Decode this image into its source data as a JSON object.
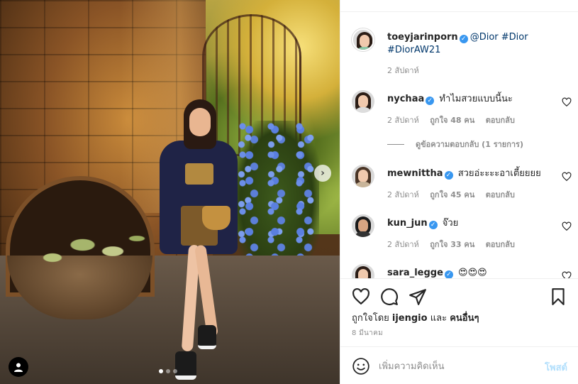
{
  "post": {
    "author": "toeyjarinporn",
    "caption_mention": "@Dior",
    "caption_tags": [
      "#Dior",
      "#DiorAW21"
    ],
    "time": "2 สัปดาห์"
  },
  "comments": [
    {
      "user": "nychaa",
      "verified": true,
      "text": "ทำไมสวยแบบนี้นะ",
      "time": "2 สัปดาห์",
      "likes": "ถูกใจ 48 คน",
      "reply": "ตอบกลับ",
      "view_replies": "ดูข้อความตอบกลับ (1 รายการ)"
    },
    {
      "user": "mewnittha",
      "verified": true,
      "text": "สวยอ่ะะะะอาเตี้ยยยย",
      "time": "2 สัปดาห์",
      "likes": "ถูกใจ 45 คน",
      "reply": "ตอบกลับ"
    },
    {
      "user": "kun_jun",
      "verified": true,
      "text": "จ๊วย",
      "time": "2 สัปดาห์",
      "likes": "ถูกใจ 33 คน",
      "reply": "ตอบกลับ"
    },
    {
      "user": "sara_legge",
      "verified": true,
      "text": "😍😍😍"
    }
  ],
  "liked_by": {
    "prefix": "ถูกใจโดย",
    "user": "ijengio",
    "conj": "และ",
    "others": "คนอื่นๆ"
  },
  "post_date": "8 มีนาคม",
  "add_comment": {
    "placeholder": "เพิ่มความคิดเห็น",
    "post_label": "โพสต์"
  },
  "carousel": {
    "count": 3,
    "active": 1
  },
  "icons": {
    "verified": "verified-badge-icon",
    "like": "heart-icon",
    "comment": "comment-bubble-icon",
    "share": "paper-plane-icon",
    "save": "bookmark-icon",
    "emoji": "smiley-icon",
    "next": "chevron-right-icon",
    "tags": "user-tag-icon"
  },
  "colors": {
    "verified": "#3897f0",
    "link": "#00376b",
    "post_disabled": "#b2dffc",
    "muted": "#8e8e8e"
  }
}
